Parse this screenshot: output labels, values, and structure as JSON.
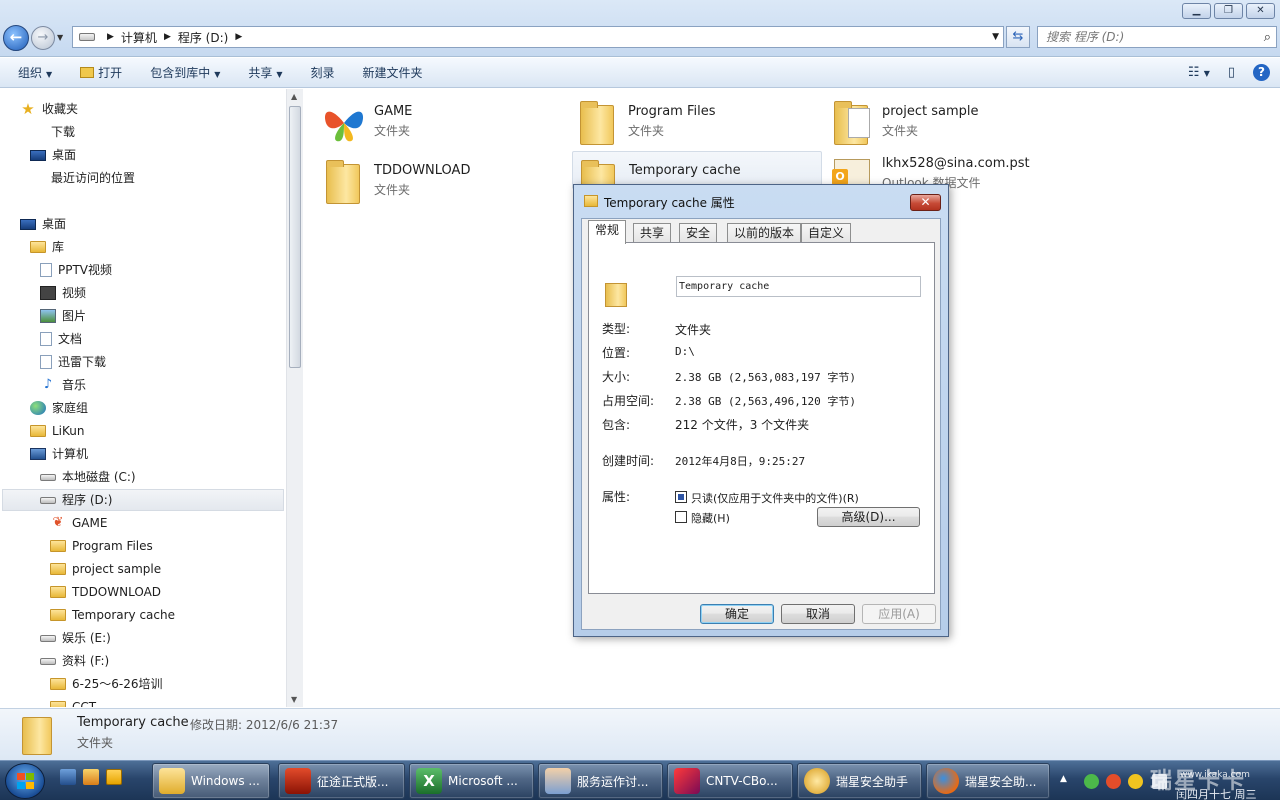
{
  "window": {
    "minimize": "▁",
    "maximize": "❐",
    "close": "✕"
  },
  "address": {
    "crumbs": [
      "计算机",
      "程序 (D:)"
    ],
    "search_placeholder": "搜索 程序 (D:)"
  },
  "toolbar": {
    "organize": "组织",
    "open": "打开",
    "include_library": "包含到库中",
    "share": "共享",
    "burn": "刻录",
    "new_folder": "新建文件夹"
  },
  "nav": {
    "favorites": "收藏夹",
    "downloads": "下载",
    "desktop_fav": "桌面",
    "recent": "最近访问的位置",
    "desktop": "桌面",
    "libraries": "库",
    "pptv": "PPTV视频",
    "videos": "视频",
    "pictures": "图片",
    "documents": "文档",
    "xunlei": "迅雷下载",
    "music": "音乐",
    "homegroup": "家庭组",
    "user": "LiKun",
    "computer": "计算机",
    "drive_c": "本地磁盘 (C:)",
    "drive_d": "程序 (D:)",
    "game": "GAME",
    "program_files": "Program Files",
    "project_sample": "project sample",
    "tddownload": "TDDOWNLOAD",
    "temp_cache": "Temporary cache",
    "drive_e": "娱乐 (E:)",
    "drive_f": "资料 (F:)",
    "training": "6-25～6-26培训",
    "cct": "CCT"
  },
  "files": [
    {
      "name": "GAME",
      "type": "文件夹"
    },
    {
      "name": "Program Files",
      "type": "文件夹"
    },
    {
      "name": "project sample",
      "type": "文件夹"
    },
    {
      "name": "TDDOWNLOAD",
      "type": "文件夹"
    },
    {
      "name": "Temporary cache",
      "type": ""
    },
    {
      "name": "lkhx528@sina.com.pst",
      "type": "Outlook 数据文件"
    }
  ],
  "dialog": {
    "title": "Temporary cache 属性",
    "tabs": [
      "常规",
      "共享",
      "安全",
      "以前的版本",
      "自定义"
    ],
    "name": "Temporary cache",
    "type_label": "类型:",
    "type_value": "文件夹",
    "location_label": "位置:",
    "location_value": "D:\\",
    "size_label": "大小:",
    "size_value": "2.38 GB (2,563,083,197 字节)",
    "disk_label": "占用空间:",
    "disk_value": "2.38 GB (2,563,496,120 字节)",
    "contains_label": "包含:",
    "contains_value": "212 个文件，3 个文件夹",
    "created_label": "创建时间:",
    "created_value": "2012年4月8日，9:25:27",
    "attributes_label": "属性:",
    "readonly_label": "只读(仅应用于文件夹中的文件)(R)",
    "hidden_label": "隐藏(H)",
    "advanced_button": "高级(D)...",
    "ok": "确定",
    "cancel": "取消",
    "apply": "应用(A)"
  },
  "details": {
    "name": "Temporary cache",
    "modified": "修改日期: 2012/6/6 21:37",
    "type": "文件夹"
  },
  "taskbar": {
    "buttons": [
      "Windows ...",
      "征途正式版...",
      "Microsoft ...",
      "服务运作讨...",
      "CNTV-CBo...",
      "瑞星安全助手",
      "瑞星安全助..."
    ],
    "watermark": "瑞星卡卡",
    "watermark_url": "www.ikaka.com",
    "date": "闰四月十七 周三"
  }
}
